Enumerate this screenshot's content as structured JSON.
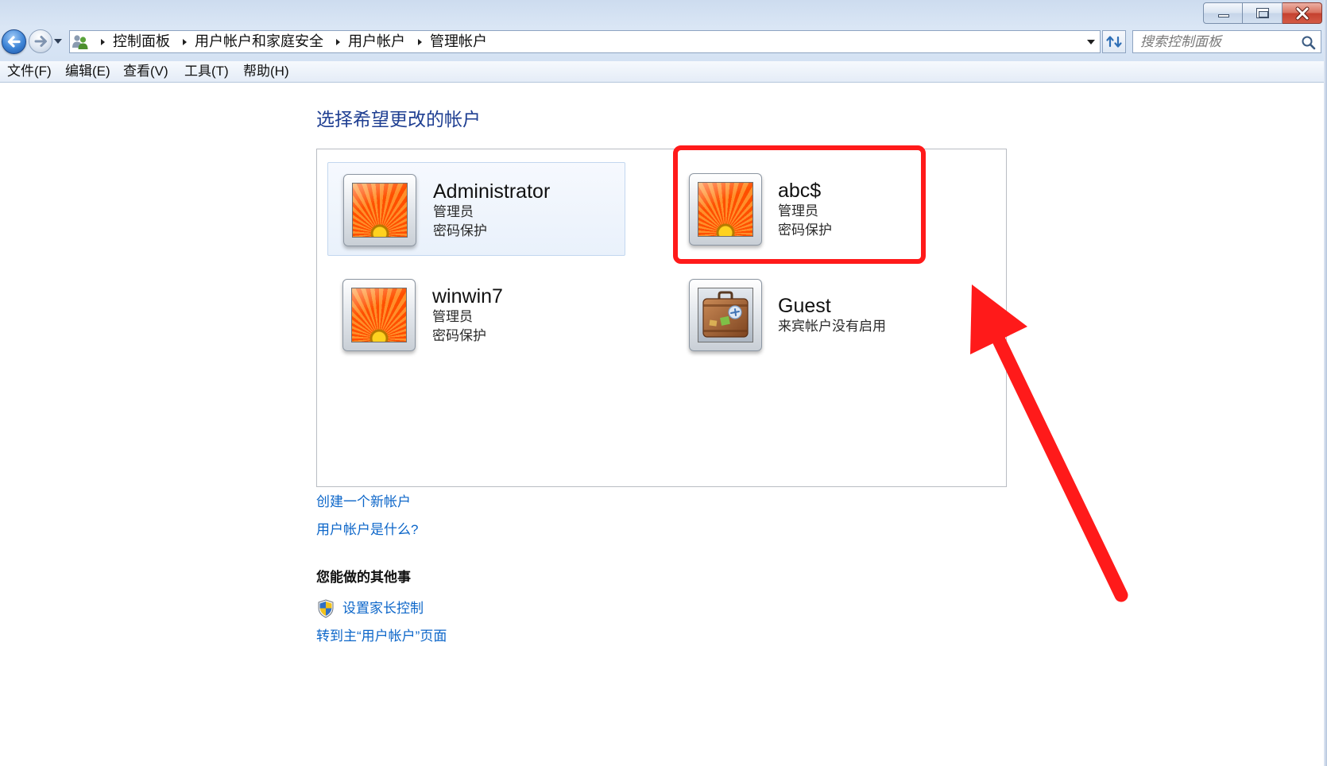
{
  "window": {
    "controls": [
      "minimize-icon",
      "maximize-icon",
      "close-icon"
    ]
  },
  "nav": {
    "back_icon": "back-arrow-icon",
    "forward_icon": "forward-arrow-icon",
    "location_icon": "user-accounts-icon",
    "breadcrumb": [
      "控制面板",
      "用户帐户和家庭安全",
      "用户帐户",
      "管理帐户"
    ],
    "refresh_icon": "refresh-icon",
    "search_placeholder": "搜索控制面板",
    "search_icon": "search-icon"
  },
  "menu": [
    "文件(F)",
    "编辑(E)",
    "查看(V)",
    "工具(T)",
    "帮助(H)"
  ],
  "main": {
    "heading": "选择希望更改的帐户",
    "accounts": [
      {
        "name": "Administrator",
        "lines": [
          "管理员",
          "密码保护"
        ],
        "icon": "flower-avatar-icon",
        "selected": true
      },
      {
        "name": "abc$",
        "lines": [
          "管理员",
          "密码保护"
        ],
        "icon": "flower-avatar-icon",
        "selected": false
      },
      {
        "name": "winwin7",
        "lines": [
          "管理员",
          "密码保护"
        ],
        "icon": "flower-avatar-icon",
        "selected": false
      },
      {
        "name": "Guest",
        "lines": [
          "来宾帐户没有启用"
        ],
        "icon": "suitcase-avatar-icon",
        "selected": false
      }
    ],
    "links": [
      "创建一个新帐户",
      "用户帐户是什么?"
    ],
    "other_heading": "您能做的其他事",
    "other_links": [
      {
        "label": "设置家长控制",
        "icon": "uac-shield-icon"
      },
      {
        "label": "转到主“用户帐户”页面"
      }
    ]
  },
  "annotation": {
    "color": "#ff1a1a",
    "box_icon": "red-highlight-box-icon",
    "arrow_icon": "red-arrow-icon"
  },
  "colors": {
    "heading": "#1f3f92",
    "link": "#0c66c9",
    "selection_bg": "#e9f1fb",
    "close_button": "#c4412f"
  }
}
